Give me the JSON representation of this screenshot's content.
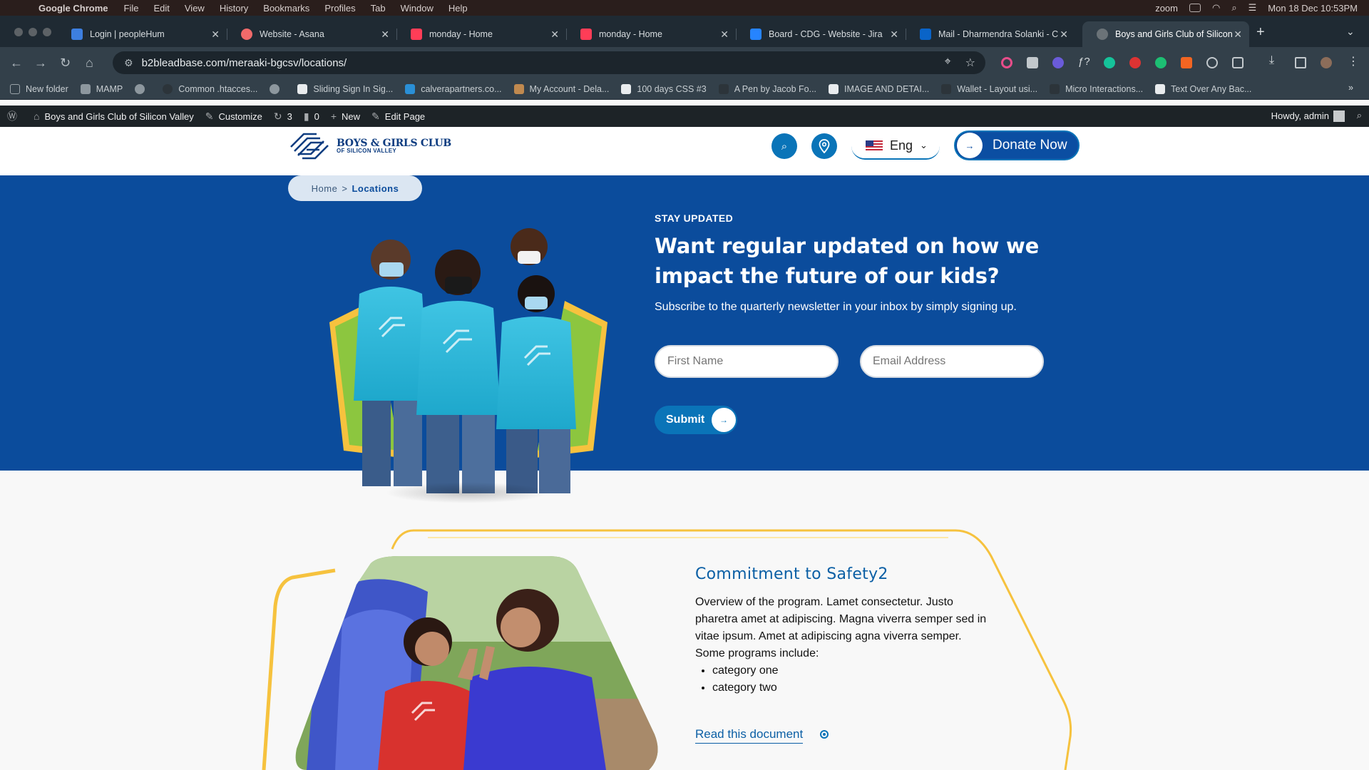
{
  "menubar": {
    "app": "Google Chrome",
    "items": [
      "File",
      "Edit",
      "View",
      "History",
      "Bookmarks",
      "Profiles",
      "Tab",
      "Window",
      "Help"
    ],
    "zoom": "zoom",
    "datetime": "Mon 18 Dec  10:53PM"
  },
  "tabs": [
    {
      "title": "Login | peopleHum",
      "color": "#3d7fe0"
    },
    {
      "title": "Website - Asana",
      "color": "#f06a6a"
    },
    {
      "title": "monday - Home",
      "color": "#ff3d57"
    },
    {
      "title": "monday - Home",
      "color": "#ff3d57"
    },
    {
      "title": "Board - CDG - Website - Jira",
      "color": "#2684ff"
    },
    {
      "title": "Mail - Dharmendra Solanki - C",
      "color": "#0a64c8"
    },
    {
      "title": "Boys and Girls Club of Silicon",
      "color": "#6b7378"
    }
  ],
  "address": {
    "url": "b2bleadbase.com/meraaki-bgcsv/locations/"
  },
  "bookmarks": [
    "New folder",
    "MAMP",
    "",
    "Common .htacces...",
    "",
    "Sliding Sign In Sig...",
    "calverapartners.co...",
    "My Account - Dela...",
    "100 days CSS #3",
    "A Pen by Jacob Fo...",
    "IMAGE AND DETAI...",
    "Wallet - Layout usi...",
    "Micro Interactions...",
    "Text Over Any Bac..."
  ],
  "wpbar": {
    "site": "Boys and Girls Club of Silicon Valley",
    "customize": "Customize",
    "updates": "3",
    "comments": "0",
    "new": "New",
    "edit": "Edit Page",
    "howdy": "Howdy, admin"
  },
  "header": {
    "logo_line1": "BOYS & GIRLS CLUB",
    "logo_line2": "OF SILICON VALLEY",
    "lang": "Eng",
    "donate": "Donate Now"
  },
  "breadcrumb": {
    "home": "Home",
    "sep": ">",
    "current": "Locations"
  },
  "newsletter": {
    "eyebrow": "STAY UPDATED",
    "headline": "Want regular updated on how we impact the future of our kids?",
    "subtext": "Subscribe to the quarterly newsletter in your inbox by simply signing up.",
    "first_name_placeholder": "First Name",
    "email_placeholder": "Email Address",
    "submit": "Submit"
  },
  "safety": {
    "title": "Commitment to Safety2",
    "body": "Overview of the program. Lamet consectetur. Justo pharetra amet at adipiscing. Magna viverra semper sed in vitae ipsum. Amet at adipiscing agna viverra semper. Some programs include:",
    "items": [
      "category one",
      "category two"
    ],
    "link": "Read this document"
  },
  "colors": {
    "brand_blue": "#0b4c9c",
    "accent_blue": "#0a74b8",
    "accent_yellow": "#f6c23e",
    "accent_green": "#8cc63f"
  }
}
